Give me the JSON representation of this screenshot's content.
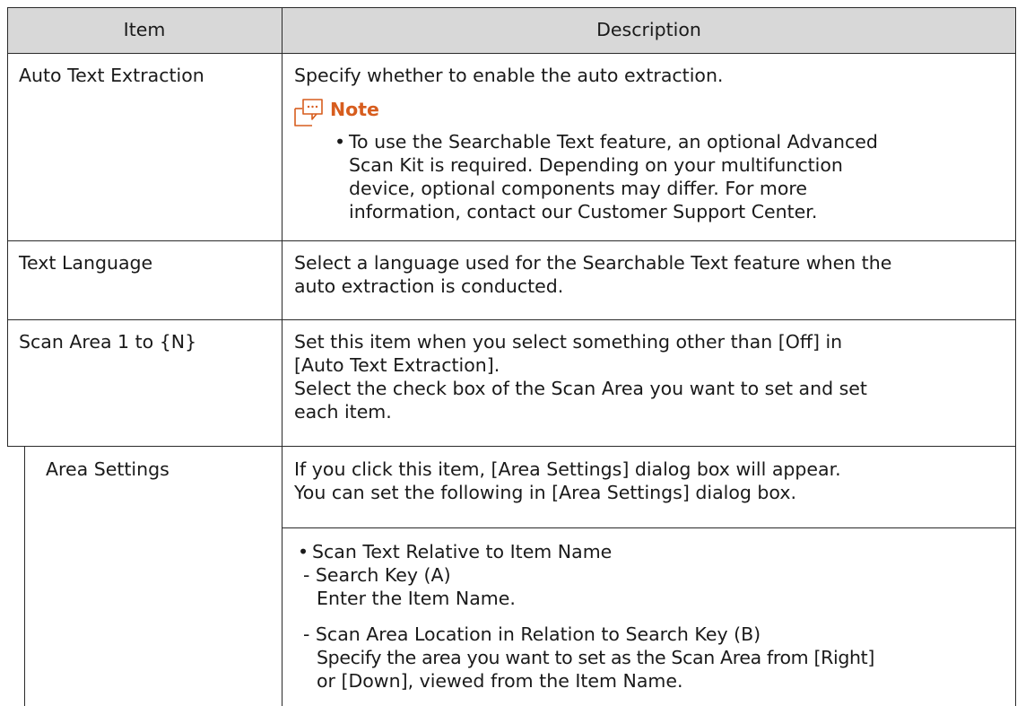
{
  "table": {
    "headers": {
      "item": "Item",
      "description": "Description"
    },
    "rows": [
      {
        "item": "Auto Text Extraction",
        "description_lines": [
          "Specify whether to enable the auto extraction."
        ],
        "note": {
          "icon": "note-icon",
          "title": "Note",
          "bullet": "•",
          "lines": [
            "To use the Searchable Text feature, an optional Advanced",
            "Scan Kit is required. Depending on your multifunction",
            "device, optional components may differ. For more",
            "information, contact our Customer Support Center."
          ]
        }
      },
      {
        "item": "Text Language",
        "description_lines": [
          "Select a language used for the Searchable Text feature when the",
          "auto extraction is conducted."
        ]
      },
      {
        "item": "Scan Area 1 to {N}",
        "description_lines": [
          "Set this item when you select something other than [Off] in",
          "[Auto Text Extraction].",
          "Select the check box of the Scan Area you want to set and set",
          "each item."
        ]
      },
      {
        "item": "Area Settings",
        "description_lines": [
          "If you click this item, [Area Settings] dialog box will appear.",
          "You can set the following in [Area Settings] dialog box."
        ],
        "bullet": "•",
        "bullet_title": "Scan Text Relative to Item Name",
        "sub_items": [
          {
            "label": "- Search Key (A)",
            "detail_lines": [
              "Enter the Item Name."
            ]
          },
          {
            "label": "- Scan Area Location in Relation to Search Key (B)",
            "detail_lines": [
              "Specify the area you want to set as the Scan Area from [Right]",
              "or [Down], viewed from the Item Name."
            ]
          }
        ]
      }
    ]
  },
  "colors": {
    "header_bg": "#d8d8d8",
    "border": "#2a2a2a",
    "text": "#1a1a1a",
    "note_accent": "#d75d1e"
  }
}
